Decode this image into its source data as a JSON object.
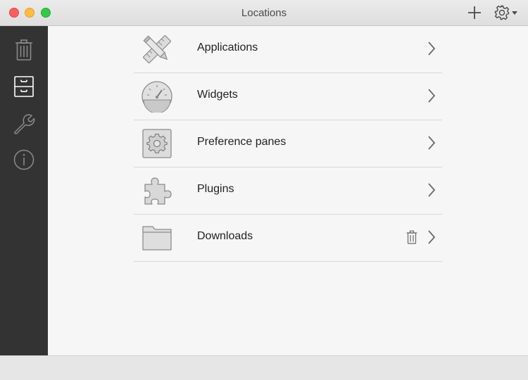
{
  "window": {
    "title": "Locations"
  },
  "toolbar": {
    "add_icon": "plus-icon",
    "settings_icon": "gear-dropdown-icon"
  },
  "sidebar": {
    "items": [
      {
        "icon": "trash-icon",
        "selected": false
      },
      {
        "icon": "cabinet-icon",
        "selected": true
      },
      {
        "icon": "wrench-icon",
        "selected": false
      },
      {
        "icon": "info-icon",
        "selected": false
      }
    ]
  },
  "locations": [
    {
      "label": "Applications",
      "icon": "applications-icon",
      "has_trash": false
    },
    {
      "label": "Widgets",
      "icon": "widgets-dashboard-icon",
      "has_trash": false
    },
    {
      "label": "Preference panes",
      "icon": "preference-pane-icon",
      "has_trash": false
    },
    {
      "label": "Plugins",
      "icon": "plugins-puzzle-icon",
      "has_trash": false
    },
    {
      "label": "Downloads",
      "icon": "downloads-folder-icon",
      "has_trash": true
    }
  ],
  "colors": {
    "sidebar_bg": "#333333",
    "sidebar_icon": "#8a8a8a",
    "sidebar_icon_selected": "#ffffff",
    "content_bg": "#f6f6f6",
    "divider": "#d8d8d8"
  }
}
